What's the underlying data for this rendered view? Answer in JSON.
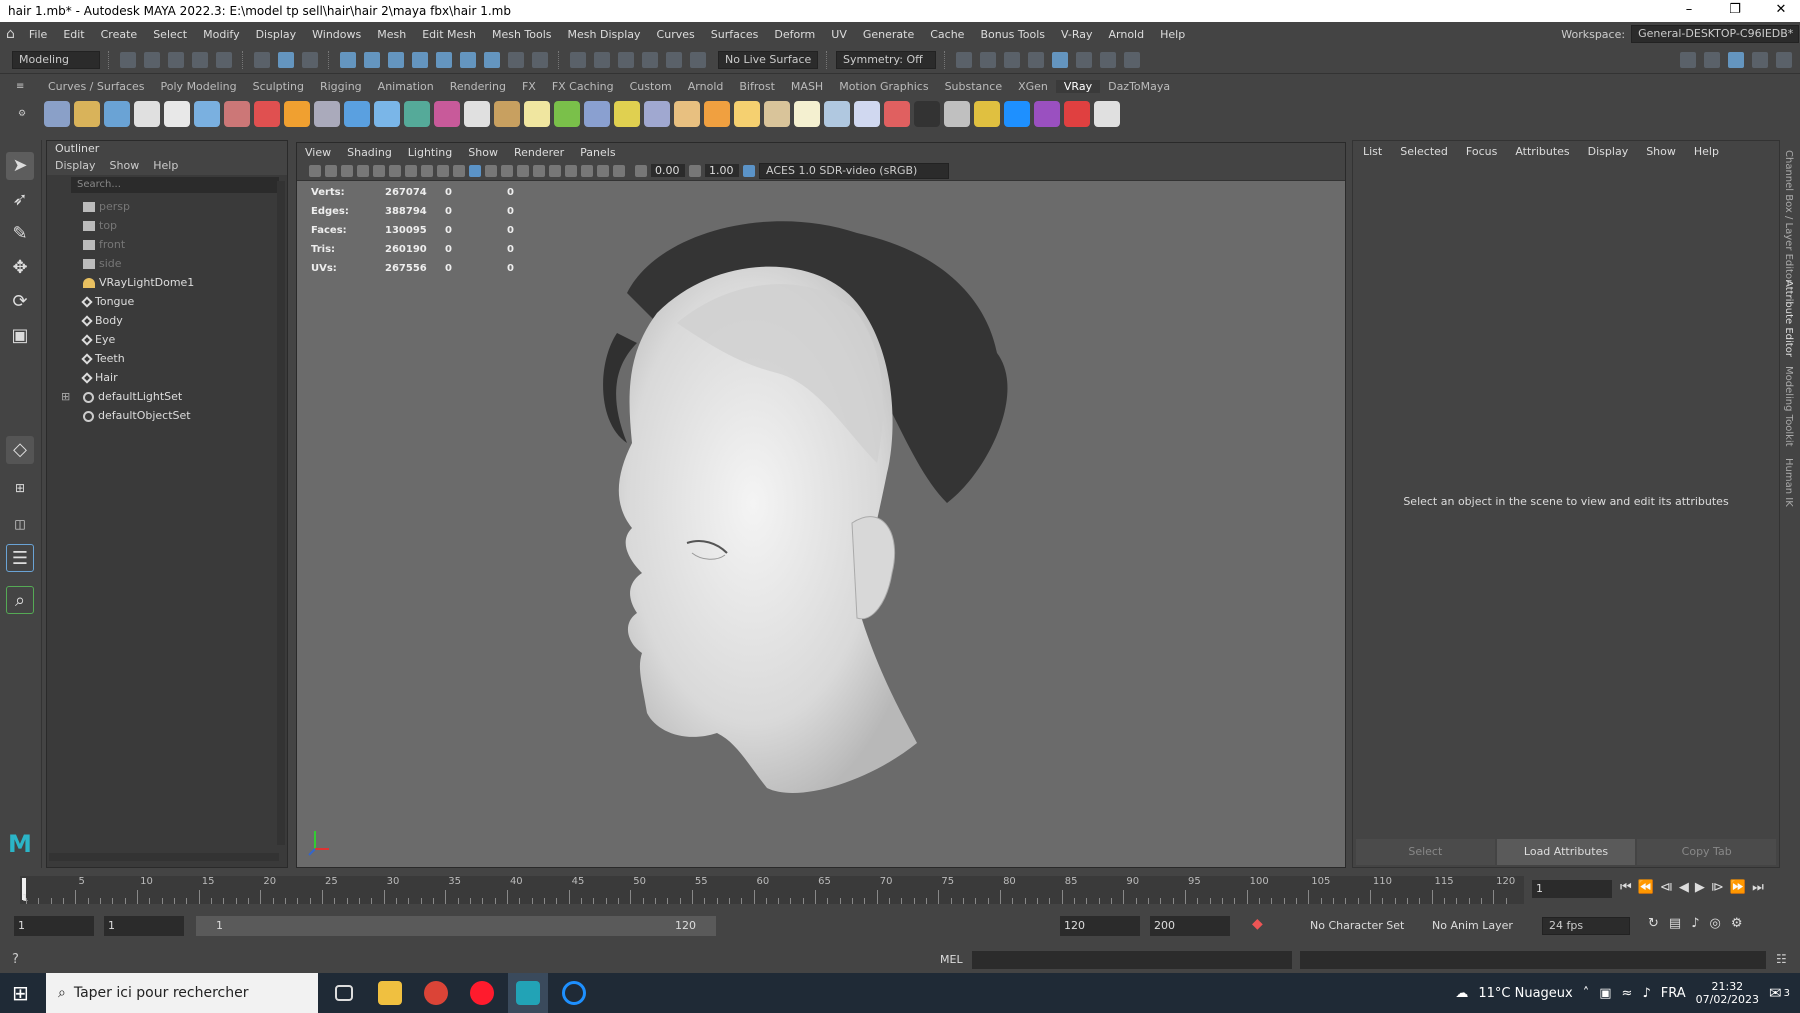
{
  "window": {
    "title": "hair 1.mb* - Autodesk MAYA 2022.3: E:\\model tp sell\\hair\\hair 2\\maya fbx\\hair 1.mb"
  },
  "menubar": {
    "items": [
      "File",
      "Edit",
      "Create",
      "Select",
      "Modify",
      "Display",
      "Windows",
      "Mesh",
      "Edit Mesh",
      "Mesh Tools",
      "Mesh Display",
      "Curves",
      "Surfaces",
      "Deform",
      "UV",
      "Generate",
      "Cache",
      "Bonus Tools",
      "V-Ray",
      "Arnold",
      "Help"
    ],
    "workspace_label": "Workspace:",
    "workspace_value": "General-DESKTOP-C96IEDB*"
  },
  "statusline": {
    "mode": "Modeling",
    "live_surface": "No Live Surface",
    "symmetry": "Symmetry: Off"
  },
  "shelf": {
    "tabs": [
      "Curves / Surfaces",
      "Poly Modeling",
      "Sculpting",
      "Rigging",
      "Animation",
      "Rendering",
      "FX",
      "FX Caching",
      "Custom",
      "Arnold",
      "Bifrost",
      "MASH",
      "Motion Graphics",
      "Substance",
      "XGen",
      "VRay",
      "DazToMaya"
    ],
    "active": "VRay",
    "icon_colors": [
      "#8aa0c8",
      "#d9b35a",
      "#6aa3d5",
      "#e0e0e0",
      "#e8e8e8",
      "#7ab0e0",
      "#c77",
      "#e05050",
      "#f0a030",
      "#aab",
      "#5aa0e0",
      "#7ab6e8",
      "#5a9",
      "#c85a9a",
      "#e0e0e0",
      "#c8a060",
      "#f0e6a0",
      "#7ac04a",
      "#8aa0d0",
      "#e0d050",
      "#a0a8d0",
      "#e8c080",
      "#f0a040",
      "#f5d070",
      "#d9c49a",
      "#f4f0d0",
      "#b0c8e0",
      "#d0d8f0",
      "#e06060",
      "#333",
      "#c0c0c0",
      "#e0c040",
      "#1e90ff",
      "#9a50c0",
      "#e04040",
      "#e0e0e0"
    ]
  },
  "outliner": {
    "title": "Outliner",
    "menu": [
      "Display",
      "Show",
      "Help"
    ],
    "search_placeholder": "Search...",
    "items": [
      {
        "label": "persp",
        "dim": true
      },
      {
        "label": "top",
        "dim": true
      },
      {
        "label": "front",
        "dim": true
      },
      {
        "label": "side",
        "dim": true
      },
      {
        "label": "VRayLightDome1",
        "dim": false
      },
      {
        "label": "Tongue",
        "dim": false
      },
      {
        "label": "Body",
        "dim": false
      },
      {
        "label": "Eye",
        "dim": false
      },
      {
        "label": "Teeth",
        "dim": false
      },
      {
        "label": "Hair",
        "dim": false
      },
      {
        "label": "defaultLightSet",
        "dim": false
      },
      {
        "label": "defaultObjectSet",
        "dim": false
      }
    ]
  },
  "viewport": {
    "menu": [
      "View",
      "Shading",
      "Lighting",
      "Show",
      "Renderer",
      "Panels"
    ],
    "exposure": "0.00",
    "gamma": "1.00",
    "colorspace": "ACES 1.0 SDR-video (sRGB)",
    "hud": [
      {
        "label": "Verts:",
        "value": "267074",
        "a": "0",
        "b": "0"
      },
      {
        "label": "Edges:",
        "value": "388794",
        "a": "0",
        "b": "0"
      },
      {
        "label": "Faces:",
        "value": "130095",
        "a": "0",
        "b": "0"
      },
      {
        "label": "Tris:",
        "value": "260190",
        "a": "0",
        "b": "0"
      },
      {
        "label": "UVs:",
        "value": "267556",
        "a": "0",
        "b": "0"
      }
    ]
  },
  "attribute_editor": {
    "menu": [
      "List",
      "Selected",
      "Focus",
      "Attributes",
      "Display",
      "Show",
      "Help"
    ],
    "message": "Select an object in the scene to view and edit its attributes",
    "buttons": [
      "Select",
      "Load Attributes",
      "Copy Tab"
    ],
    "side_tabs": [
      "Channel Box / Layer Editor",
      "Attribute Editor",
      "Modeling Toolkit",
      "Human IK"
    ]
  },
  "timeline": {
    "ticks": [
      "5",
      "10",
      "15",
      "20",
      "25",
      "30",
      "35",
      "40",
      "45",
      "50",
      "55",
      "60",
      "65",
      "70",
      "75",
      "80",
      "85",
      "90",
      "95",
      "100",
      "105",
      "110",
      "115",
      "120"
    ],
    "start_marker": "1",
    "current_frame": "1"
  },
  "range": {
    "start": "1",
    "playback_start": "1",
    "slider_start": "1",
    "slider_end": "120",
    "playback_end": "120",
    "end": "200",
    "character_set": "No Character Set",
    "anim_layer": "No Anim Layer",
    "fps": "24 fps"
  },
  "cmdline": {
    "lang": "MEL"
  },
  "taskbar": {
    "search_placeholder": "Taper ici pour rechercher",
    "weather": "11°C  Nuageux",
    "lang": "FRA",
    "time": "21:32",
    "date": "07/02/2023",
    "notifications": "3"
  }
}
